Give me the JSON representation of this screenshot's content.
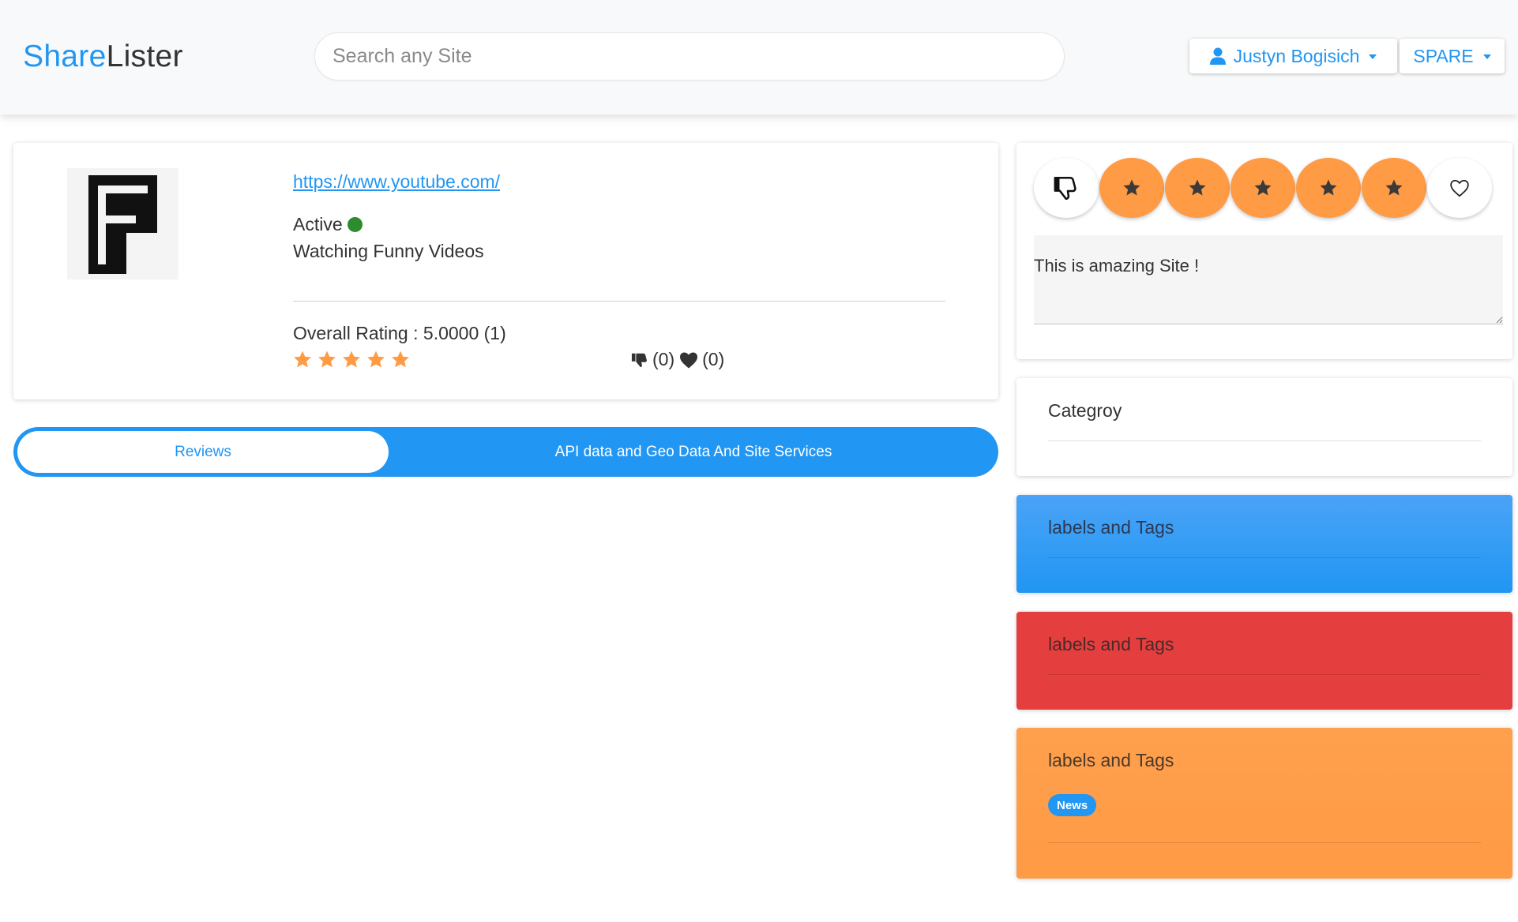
{
  "header": {
    "brand_part1": "Share",
    "brand_part2": "Lister",
    "search_placeholder": "Search any Site",
    "user_name": "Justyn Bogisich",
    "spare_label": "SPARE"
  },
  "site": {
    "url": "https://www.youtube.com/",
    "status": "Active",
    "status_color": "#2e8b2e",
    "description": "Watching Funny Videos",
    "overall_rating_text": "Overall Rating : 5.0000 (1)",
    "stars": 5,
    "dislike_count": "(0)",
    "like_count": "(0)",
    "star_color": "#ff9a45"
  },
  "tabs": [
    {
      "label": "Reviews",
      "active": true
    },
    {
      "label": "API data and Geo Data And Site Services",
      "active": false
    }
  ],
  "review": {
    "text": "This is amazing Site !",
    "buttons": [
      "thumbs-down-icon",
      "star-icon",
      "star-icon",
      "star-icon",
      "star-icon",
      "star-icon",
      "heart-icon"
    ]
  },
  "cards": {
    "category_title": "Categroy",
    "tags": [
      {
        "title": "labels and Tags",
        "color": "#2196f3"
      },
      {
        "title": "labels and Tags",
        "color": "#e53e3e"
      },
      {
        "title": "labels and Tags",
        "color": "#ff9a45",
        "badges": [
          "News"
        ]
      }
    ]
  }
}
